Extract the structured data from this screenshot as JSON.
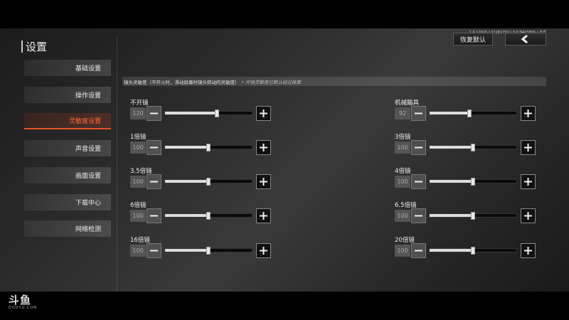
{
  "header": {
    "title": "设置",
    "version_info": "1.0.11615 | 0728175D | 52C8403895 | 正式",
    "reset_label": "恢复默认",
    "back_icon": "chevron-left-icon"
  },
  "sidebar": {
    "items": [
      {
        "label": "基础设置",
        "active": false
      },
      {
        "label": "操作设置",
        "active": false
      },
      {
        "label": "灵敏度设置",
        "active": true
      },
      {
        "label": "声音设置",
        "active": false
      },
      {
        "label": "画面设置",
        "active": false
      },
      {
        "label": "下载中心",
        "active": false
      },
      {
        "label": "网络检测",
        "active": false
      }
    ]
  },
  "section": {
    "title": "镜头灵敏度（不开火时，滑动屏幕时镜头转动的灵敏度）",
    "note": "* 开镜灵敏度已默认经过换算"
  },
  "sliders": [
    {
      "label": "不开镜",
      "value": "120",
      "level": 0.6
    },
    {
      "label": "机械瞄具",
      "value": "92",
      "level": 0.46
    },
    {
      "label": "1倍镜",
      "value": "100",
      "level": 0.5
    },
    {
      "label": "3倍镜",
      "value": "100",
      "level": 0.5
    },
    {
      "label": "3.5倍镜",
      "value": "100",
      "level": 0.5
    },
    {
      "label": "4倍镜",
      "value": "100",
      "level": 0.5
    },
    {
      "label": "6倍镜",
      "value": "100",
      "level": 0.5
    },
    {
      "label": "6.5倍镜",
      "value": "100",
      "level": 0.5
    },
    {
      "label": "16倍镜",
      "value": "100",
      "level": 0.5
    },
    {
      "label": "20倍镜",
      "value": "100",
      "level": 0.5
    }
  ],
  "watermark": {
    "logo": "斗鱼",
    "sub": "DOUYU.COM"
  }
}
